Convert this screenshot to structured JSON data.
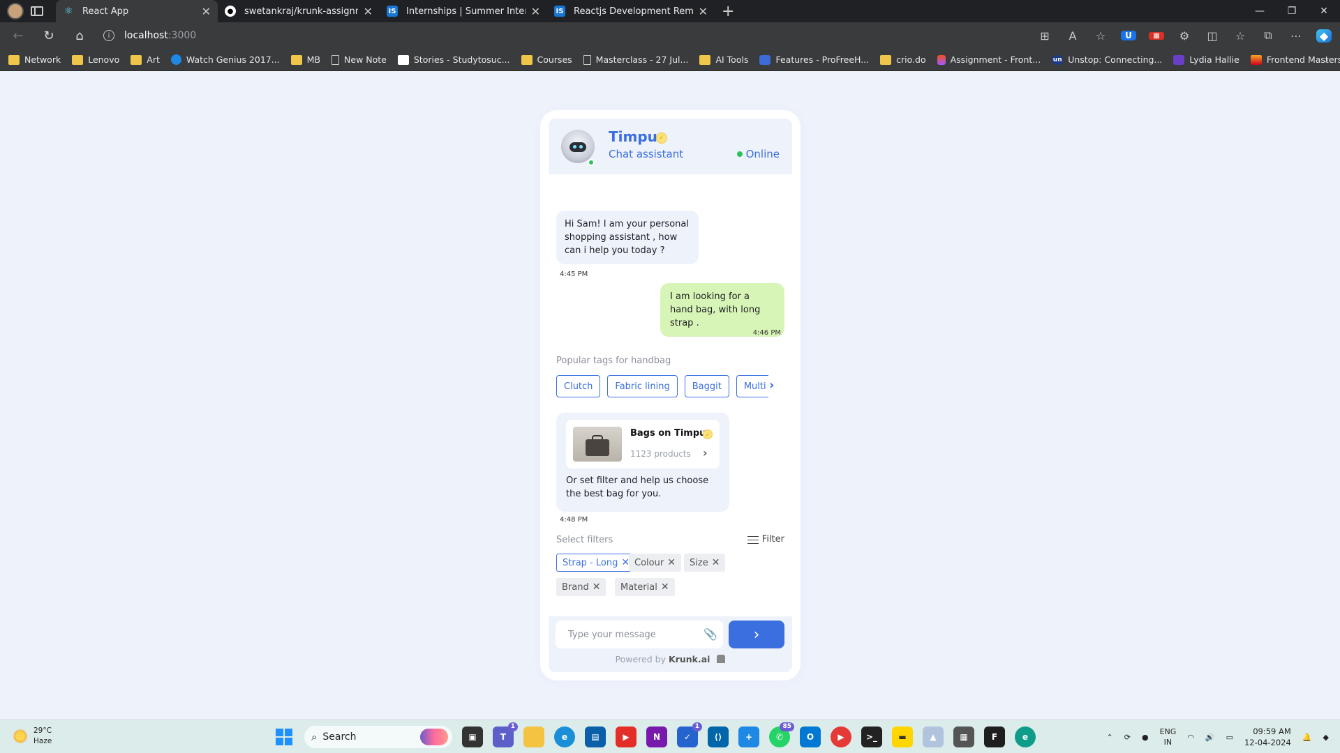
{
  "browser": {
    "tabs": [
      {
        "title": "React App",
        "icon": "react-icon",
        "active": true
      },
      {
        "title": "swetankraj/krunk-assignment",
        "icon": "github-icon",
        "active": false
      },
      {
        "title": "Internships | Summer Internship",
        "icon": "internshala-icon",
        "active": false
      },
      {
        "title": "Reactjs Development Remote Int",
        "icon": "internshala-icon",
        "active": false
      }
    ],
    "url_host": "localhost",
    "url_port": ":3000",
    "bookmarks": [
      {
        "label": "Network",
        "icon": "folder"
      },
      {
        "label": "Lenovo",
        "icon": "folder"
      },
      {
        "label": "Art",
        "icon": "folder"
      },
      {
        "label": "Watch Genius 2017...",
        "icon": "play"
      },
      {
        "label": "MB",
        "icon": "folder"
      },
      {
        "label": "New Note",
        "icon": "page"
      },
      {
        "label": "Stories - Studytosuc...",
        "icon": "dot-check"
      },
      {
        "label": "Courses",
        "icon": "folder"
      },
      {
        "label": "Masterclass - 27 Jul...",
        "icon": "page"
      },
      {
        "label": "AI Tools",
        "icon": "folder"
      },
      {
        "label": "Features - ProFreeH...",
        "icon": "dot-blue"
      },
      {
        "label": "crio.do",
        "icon": "folder"
      },
      {
        "label": "Assignment - Front...",
        "icon": "dot-fig"
      },
      {
        "label": "Unstop: Connecting...",
        "icon": "un"
      },
      {
        "label": "Lydia Hallie",
        "icon": "dot-purple"
      },
      {
        "label": "Frontend Masters –...",
        "icon": "fm"
      }
    ]
  },
  "chat": {
    "bot_name": "Timpu",
    "bot_role": "Chat assistant",
    "status": "Online",
    "messages": [
      {
        "from": "bot",
        "text": "Hi Sam! I am your personal shopping assistant , how can i help you today ?",
        "time": "4:45 PM"
      },
      {
        "from": "user",
        "text": "I am looking for a hand bag, with long strap .",
        "time": "4:46 PM"
      }
    ],
    "tags_label": "Popular tags for handbag",
    "tags": [
      "Clutch",
      "Fabric lining",
      "Baggit",
      "Multi"
    ],
    "product": {
      "title": "Bags on Timpu",
      "count": "1123 products",
      "followup": "Or set filter and help us choose the best bag for you.",
      "time": "4:48 PM"
    },
    "filters_label": "Select filters",
    "filter_button": "Filter",
    "filters": [
      {
        "label": "Strap - Long",
        "active": true
      },
      {
        "label": "Colour",
        "active": false
      },
      {
        "label": "Size",
        "active": false
      },
      {
        "label": "Brand",
        "active": false
      },
      {
        "label": "Material",
        "active": false
      }
    ],
    "input_placeholder": "Type your message",
    "powered_prefix": "Powered by",
    "powered_brand": "Krunk.ai"
  },
  "taskbar": {
    "weather_temp": "29°C",
    "weather_desc": "Haze",
    "search_placeholder": "Search",
    "teams_badge": "1",
    "todo_badge": "1",
    "whatsapp_badge": "85",
    "lang_top": "ENG",
    "lang_bottom": "IN",
    "time": "09:59 AM",
    "date": "12-04-2024"
  },
  "colors": {
    "accent": "#3b6fe0",
    "page_bg": "#eef2fb",
    "user_bubble": "#d8f5b8",
    "online": "#2ec15a"
  }
}
